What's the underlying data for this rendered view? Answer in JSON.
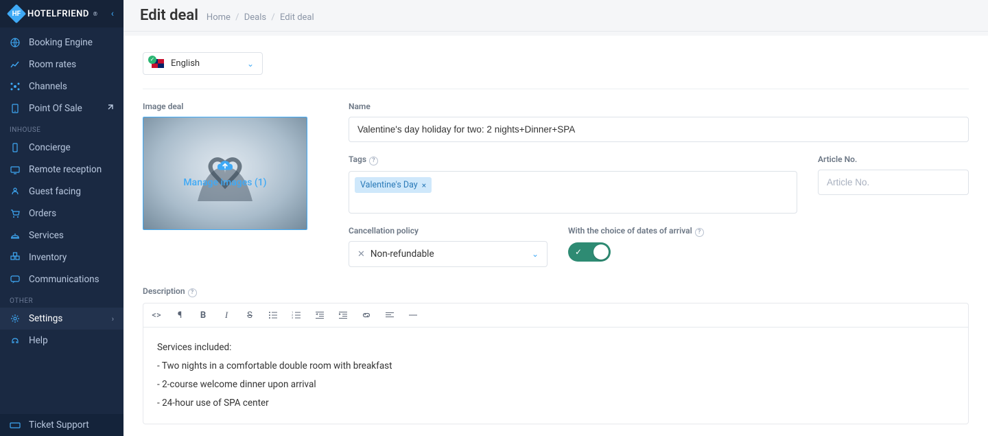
{
  "app": {
    "brand": "HOTELFRIEND"
  },
  "sidebar": {
    "items_top": [
      {
        "label": "Booking Engine",
        "icon": "globe"
      },
      {
        "label": "Room rates",
        "icon": "chart"
      },
      {
        "label": "Channels",
        "icon": "channels"
      },
      {
        "label": "Point Of Sale",
        "icon": "pos",
        "ext": true
      }
    ],
    "section_inhouse": "INHOUSE",
    "items_inhouse": [
      {
        "label": "Concierge",
        "icon": "phone"
      },
      {
        "label": "Remote reception",
        "icon": "reception"
      },
      {
        "label": "Guest facing",
        "icon": "guest"
      },
      {
        "label": "Orders",
        "icon": "cart"
      },
      {
        "label": "Services",
        "icon": "bell"
      },
      {
        "label": "Inventory",
        "icon": "inventory"
      },
      {
        "label": "Communications",
        "icon": "chat"
      }
    ],
    "section_other": "OTHER",
    "items_other": [
      {
        "label": "Settings",
        "icon": "gear",
        "chevron": true,
        "active": true
      },
      {
        "label": "Help",
        "icon": "help"
      }
    ],
    "footer": {
      "label": "Ticket Support",
      "icon": "ticket"
    }
  },
  "header": {
    "title": "Edit deal",
    "breadcrumb": [
      "Home",
      "Deals",
      "Edit deal"
    ]
  },
  "form": {
    "language": {
      "label": "English"
    },
    "image": {
      "label": "Image deal",
      "manage_text": "Manage images (1)"
    },
    "name": {
      "label": "Name",
      "value": "Valentine's day holiday for two: 2 nights+Dinner+SPA"
    },
    "tags": {
      "label": "Tags",
      "items": [
        "Valentine's Day"
      ]
    },
    "article_no": {
      "label": "Article No.",
      "placeholder": "Article No."
    },
    "cancellation": {
      "label": "Cancellation policy",
      "value": "Non-refundable"
    },
    "arrival_dates": {
      "label": "With the choice of dates of arrival",
      "on": true
    },
    "description": {
      "label": "Description",
      "lines": [
        "Services included:",
        "- Two nights in a comfortable double room with breakfast",
        "- 2-course welcome dinner upon arrival",
        "- 24-hour use of SPA center"
      ]
    }
  }
}
